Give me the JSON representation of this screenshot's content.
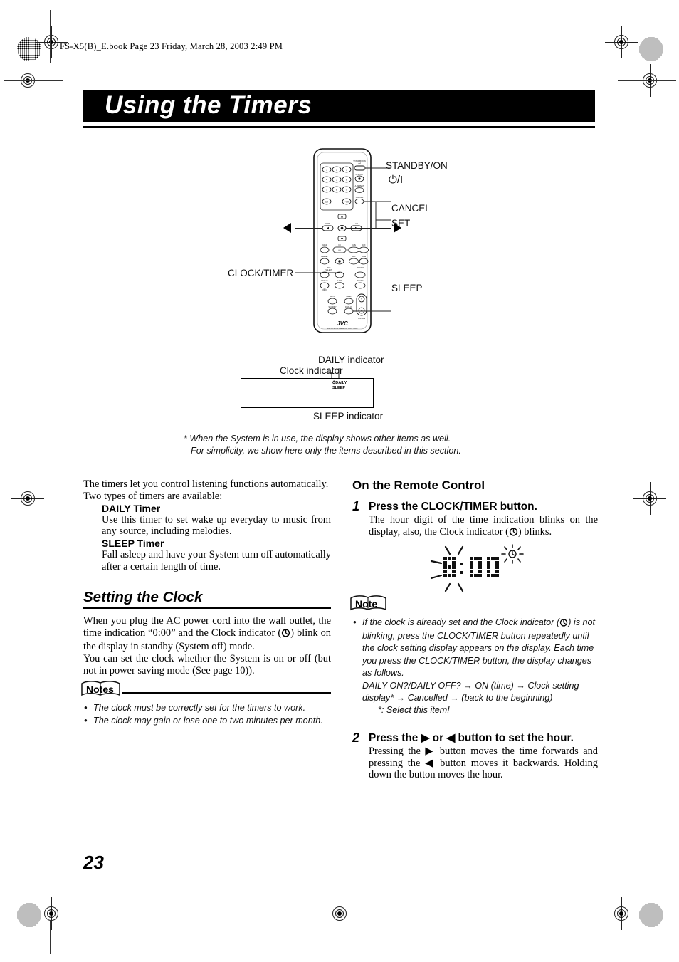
{
  "header": {
    "file_line": "FS-X5(B)_E.book  Page 23  Friday, March 28, 2003  2:49 PM"
  },
  "title": {
    "text": "Using the Timers"
  },
  "remote_diagram": {
    "brand": "JVC",
    "model_line": "RM-SFSX5R REMOTE CONTROL",
    "callouts": {
      "standby_on": "STANDBY/ON",
      "standby_symbol": "⏻/I",
      "cancel": "CANCEL",
      "set": "SET",
      "clock_timer": "CLOCK/TIMER",
      "sleep": "SLEEP",
      "left_arrow": "◀",
      "right_arrow": "▶"
    },
    "keypad": [
      "1",
      "2",
      "3",
      "4",
      "5",
      "6",
      "7",
      "8",
      "9",
      "10",
      "+10"
    ]
  },
  "display_diagram": {
    "daily_label": "DAILY indicator",
    "clock_label": "Clock indicator",
    "sleep_label": "SLEEP indicator",
    "panel_daily": "DAILY",
    "panel_sleep": "SLEEP"
  },
  "footnote": {
    "line1": "* When the System is in use, the display shows other items as well.",
    "line2": "For simplicity, we show here only the items described in this section."
  },
  "left_column": {
    "intro": "The timers let you control listening functions automatically. Two types of timers are available:",
    "daily_heading": "DAILY Timer",
    "daily_text": "Use this timer to set wake up everyday to music from any source, including melodies.",
    "sleep_heading": "SLEEP Timer",
    "sleep_text": "Fall asleep and have your System turn off automatically after a certain length of time.",
    "section_heading": "Setting the Clock",
    "para1_a": "When you plug the AC power cord into the wall outlet, the time indication “0:00” and the Clock indicator (",
    "para1_b": ") blink on the display in standby (System off) mode.",
    "para2": "You can set the clock whether the System is on or off (but not in power saving mode (See page 10)).",
    "notes_badge": "Notes",
    "notes": [
      "The clock must be correctly set for the timers to work.",
      "The clock may gain or lose one to two minutes per month."
    ]
  },
  "right_column": {
    "heading": "On the Remote Control",
    "step1": {
      "number": "1",
      "title": "Press the CLOCK/TIMER button.",
      "body_a": "The hour digit of the time indication blinks on the display, also, the Clock indicator (",
      "body_b": ") blinks."
    },
    "time_display": {
      "hour": "0",
      "colon": ":",
      "minutes": "00",
      "full": "0:00"
    },
    "note_badge": "Note",
    "note_lines": [
      "If the clock is already set and the Clock indicator (",
      ") is not blinking, press the CLOCK/TIMER button repeatedly until the clock setting display appears on the display. Each time you press the CLOCK/TIMER button, the display changes as follows.",
      "DAILY ON?/DAILY OFF? → ON (time) → Clock setting display* → Cancelled → (back to the beginning)",
      "*: Select this item!"
    ],
    "step2": {
      "number": "2",
      "title": "Press the ▶ or ◀ button to set the hour.",
      "body": "Pressing the ▶ button moves the time forwards and pressing the ◀ button moves it backwards. Holding down the button moves the hour."
    }
  },
  "footer": {
    "page_number": "23"
  }
}
